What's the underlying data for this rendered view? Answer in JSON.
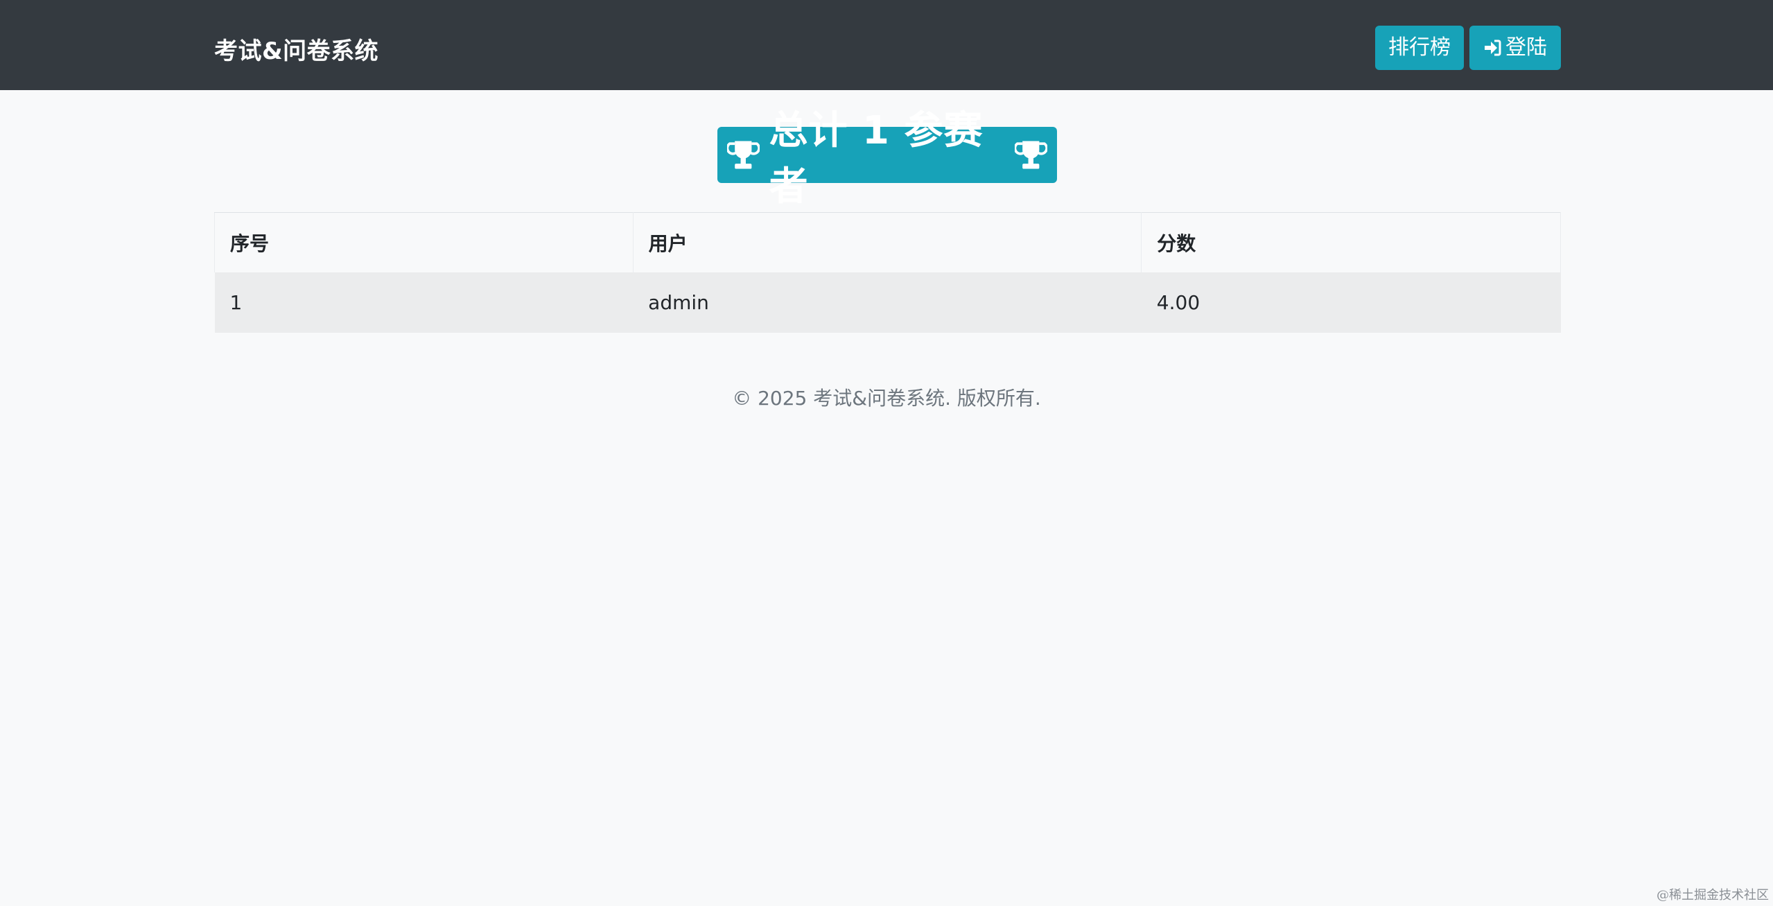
{
  "header": {
    "brand": "考试&问卷系统",
    "rank_button": "排行榜",
    "login_button": "登陆"
  },
  "banner": {
    "text": "总计 1 参赛者"
  },
  "table": {
    "headers": [
      "序号",
      "用户",
      "分数"
    ],
    "rows": [
      [
        "1",
        "admin",
        "4.00"
      ]
    ]
  },
  "footer": {
    "text": "© 2025 考试&问卷系统.  版权所有."
  },
  "watermark": "@稀土掘金技术社区",
  "colors": {
    "navbar": "#343a40",
    "accent": "#17a2b8",
    "background": "#f8f9fa",
    "row_bg": "#ebeced"
  },
  "icons": {
    "banner_left": "trophy-icon",
    "banner_right": "trophy-icon",
    "login": "sign-in-icon"
  }
}
